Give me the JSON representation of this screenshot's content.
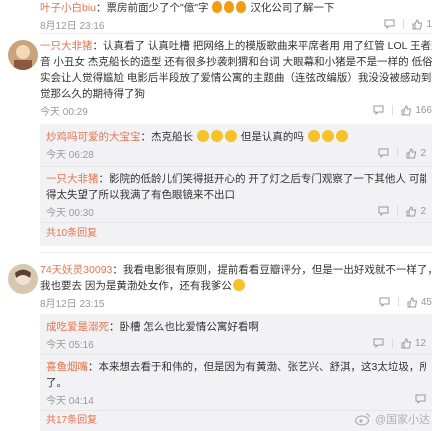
{
  "c1": {
    "user": "叶子小白biu",
    "text": "：票房前面少了个\"億\"字",
    "text2": "汉化公司了解一下",
    "time": "8月12日 23:16",
    "like": "1"
  },
  "c2": {
    "user": "一只大非猪",
    "text_l1": "：认真看了 认真吐槽 把网络上的模版歌曲来平席者用 用了红管 LOL 王者荣耀的名种语",
    "text_l2": "音 小丑女 杰克船长的造型 还有很多抄袭刺猬和台词 大眼幕和小猪是不是一样的 低俗无趣的笑点确",
    "text_l3": "实会让人觉得尴尬 电影后半段放了爱情公寓的主题曲（连弦改编版）我没没被感动到了个白眼 感",
    "text_l4": "觉那么久的期待得了狗",
    "time": "今天 00:29",
    "like": "166",
    "replies": [
      {
        "user": "炒鸡吗可爱的大宝宝",
        "text": "：杰克船长",
        "text2": "但是认真的吗",
        "time": "今天 06:28",
        "like": "2"
      },
      {
        "user": "一只大非猪",
        "text_l1": "：影院的低龄儿们笑得挺开心的 开了灯之后专门观察了一下其他人 可能是因为觉",
        "text_l2": "得太失望了所以我满了有色眼镜来不出口",
        "time": "今天 00:30",
        "like": "2"
      }
    ],
    "more": "共10条回复"
  },
  "c3": {
    "user": "74天妖灵30093",
    "text_l1": "：我看电影很有原则，提前看看豆瓣评分，但是一出好戏就不一样了，它就算没分",
    "text_l2": "我也要去 因为是黄渤处女作，还有我爹公",
    "time": "8月12日 23:15",
    "like": "45",
    "replies": [
      {
        "user": "成吃爱是溺死",
        "text": "：卧槽 怎么也比爱情公寓好看啊",
        "time": "今天 05:16",
        "like": "12"
      },
      {
        "user": "喜鱼烟嘴",
        "text_l1": "：本来想去看于和伟的，但是因为有黄渤、张艺兴、舒淇，这3太垃圾，所以不看",
        "text_l2": "了。",
        "time": "今天 04:14",
        "like": ""
      }
    ],
    "more": "共17条回复"
  },
  "watermark": "@国家小达"
}
